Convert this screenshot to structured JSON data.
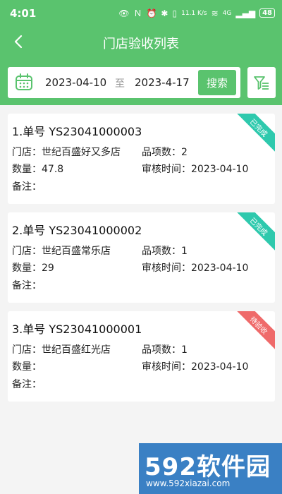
{
  "status_bar": {
    "time": "4:01",
    "network": "11.1 K/s",
    "signal": "4G",
    "battery": "48"
  },
  "nav": {
    "title": "门店验收列表"
  },
  "search": {
    "date_from": "2023-04-10",
    "separator": "至",
    "date_to": "2023-4-17",
    "button_label": "搜索"
  },
  "labels": {
    "store": "门店：",
    "item_count": "品项数：",
    "quantity": "数量：",
    "review_time": "审核时间：",
    "note": "备注："
  },
  "orders": [
    {
      "order_no": "1.单号 YS23041000003",
      "store": "世纪百盛好又多店",
      "item_count": "2",
      "quantity": "47.8",
      "review_time": "2023-04-10",
      "note": "",
      "status": "已完成"
    },
    {
      "order_no": "2.单号 YS23041000002",
      "store": "世纪百盛常乐店",
      "item_count": "1",
      "quantity": "29",
      "review_time": "2023-04-10",
      "note": "",
      "status": "已完成"
    },
    {
      "order_no": "3.单号 YS23041000001",
      "store": "世纪百盛红光店",
      "item_count": "1",
      "quantity": "",
      "review_time": "2023-04-10",
      "note": "",
      "status": "待验收"
    }
  ],
  "watermark": {
    "brand": "592软件园",
    "url": "www.592xiazai.com"
  },
  "colors": {
    "primary": "#5ac36e",
    "done": "#2ec9ad",
    "pending": "#ef6a6a",
    "watermark": "#3a80c4"
  }
}
